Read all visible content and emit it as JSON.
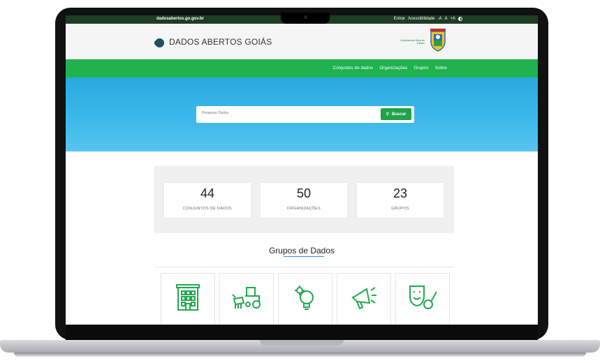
{
  "topbar": {
    "domain": "dadosabertos.go.gov.br",
    "links": [
      "Entrar",
      "Acessibilidade",
      "-A",
      "A",
      "+A"
    ]
  },
  "header": {
    "title": "DADOS ABERTOS GOIÁS",
    "partner_text": "Controladoria Geral do Estado"
  },
  "nav": {
    "items": [
      "Conjuntos de dados",
      "Organizações",
      "Grupos",
      "Sobre"
    ]
  },
  "search": {
    "placeholder": "Pesquisar Dados",
    "button_label": "Buscar"
  },
  "stats": [
    {
      "value": "44",
      "label": "CONJUNTOS DE DADOS"
    },
    {
      "value": "50",
      "label": "ORGANIZAÇÕES"
    },
    {
      "value": "23",
      "label": "GRUPOS"
    }
  ],
  "groups": {
    "title": "Grupos de Dados",
    "items": [
      {
        "icon": "building-icon"
      },
      {
        "icon": "tractor-cow-icon"
      },
      {
        "icon": "gear-lightbulb-icon"
      },
      {
        "icon": "megaphone-icon"
      },
      {
        "icon": "theater-guitar-icon"
      }
    ]
  },
  "colors": {
    "topbar": "#1e3d24",
    "nav": "#1fb24f",
    "hero": "#28a9df",
    "button": "#1fa34a",
    "icon_green": "#22a84d"
  }
}
